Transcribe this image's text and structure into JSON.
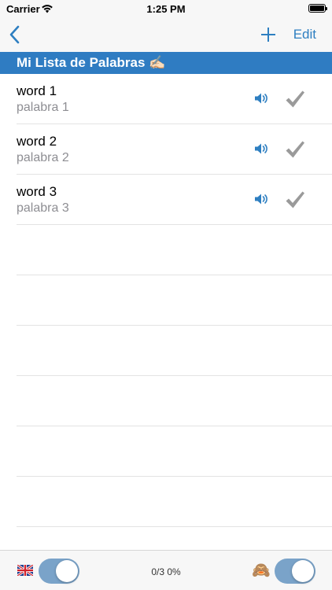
{
  "status_bar": {
    "carrier": "Carrier",
    "time": "1:25 PM"
  },
  "nav": {
    "edit_label": "Edit"
  },
  "section": {
    "title": "Mi Lista de Palabras ✍🏻"
  },
  "words": [
    {
      "word": "word 1",
      "translation": "palabra 1"
    },
    {
      "word": "word 2",
      "translation": "palabra 2"
    },
    {
      "word": "word 3",
      "translation": "palabra 3"
    }
  ],
  "toolbar": {
    "progress": "0/3 0%",
    "left_toggle_on": true,
    "right_toggle_on": true,
    "monkey_emoji": "🙈"
  },
  "colors": {
    "accent": "#2e7fc1",
    "header_bg": "#2f7cc2",
    "check": "#9a9a9a",
    "toggle": "#7aa3c9"
  }
}
